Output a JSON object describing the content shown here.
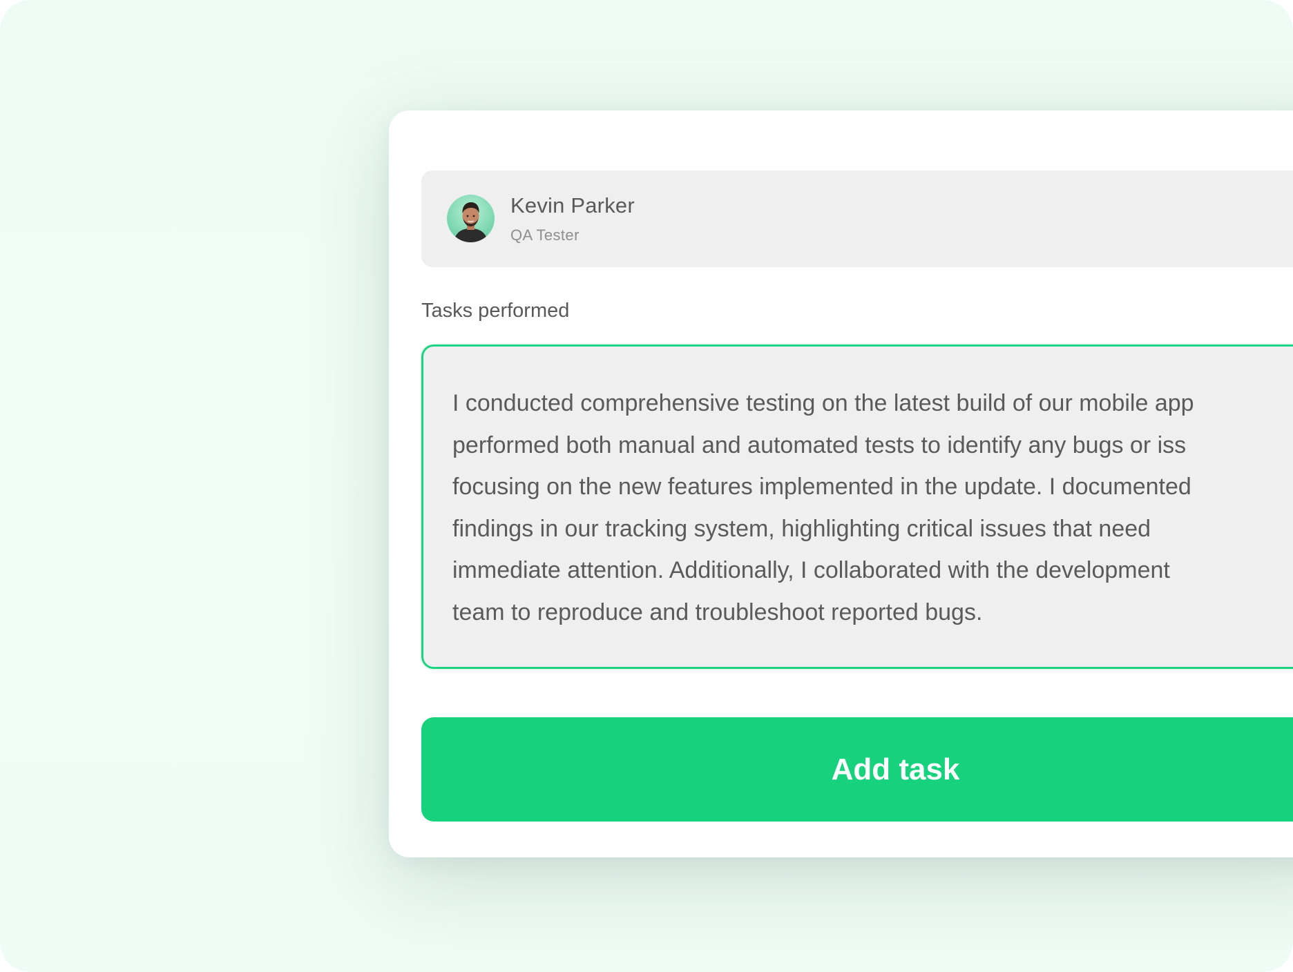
{
  "user": {
    "name": "Kevin Parker",
    "role": "QA Tester",
    "avatar_icon": "person-avatar-icon"
  },
  "tasks_field": {
    "label": "Tasks performed",
    "value_lines": [
      "I conducted comprehensive testing on the latest build of our mobile app",
      "performed both manual and automated tests to identify any bugs or iss",
      "focusing on the new features implemented in the update. I documented",
      "findings in our tracking system, highlighting critical issues that need",
      "immediate attention. Additionally, I collaborated with the development",
      "team to reproduce and troubleshoot reported bugs."
    ]
  },
  "actions": {
    "add_task_label": "Add task"
  },
  "colors": {
    "accent": "#17d27d",
    "focus_border": "#1dd282",
    "field_bg": "#efefef",
    "page_bg": "#eefbf4"
  }
}
